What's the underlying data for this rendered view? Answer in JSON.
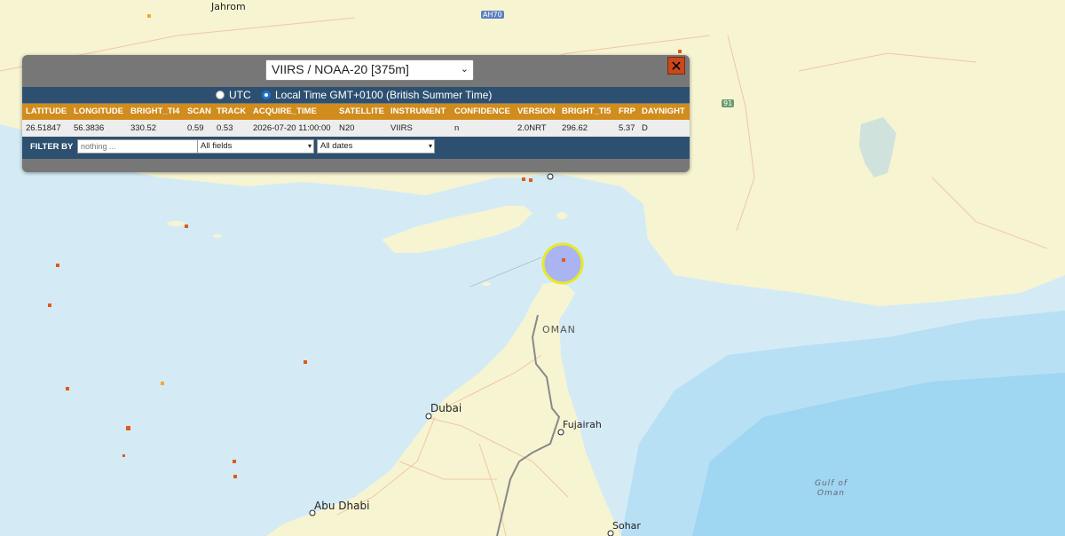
{
  "map": {
    "places": {
      "jahrom": "Jahrom",
      "oman": "OMAN",
      "dubai": "Dubai",
      "fujairah": "Fujairah",
      "abu_dhabi": "Abu Dhabi",
      "sohar": "Sohar",
      "gulf_of_oman": "Gulf of\nOman"
    },
    "shields": {
      "ah70": "AH70",
      "r91": "91"
    },
    "colors": {
      "land": "#f7f4d2",
      "water": "#d4ebf6",
      "deep_water": "#8fd0f0",
      "hotspot": "#e05a18",
      "selection": "#aab4f0",
      "selection_ring": "#e8e82a"
    }
  },
  "popup": {
    "satellite_select": "VIIRS / NOAA-20 [375m]",
    "close": "✕",
    "time": {
      "utc_label": "UTC",
      "local_label": "Local Time GMT+0100 (British Summer Time)",
      "selected": "local"
    },
    "columns": [
      "LATITUDE",
      "LONGITUDE",
      "BRIGHT_TI4",
      "SCAN",
      "TRACK",
      "ACQUIRE_TIME",
      "SATELLITE",
      "INSTRUMENT",
      "CONFIDENCE",
      "VERSION",
      "BRIGHT_TI5",
      "FRP",
      "DAYNIGHT"
    ],
    "row": [
      "26.51847",
      "56.3836",
      "330.52",
      "0.59",
      "0.53",
      "2026-07-20 11:00:00",
      "N20",
      "VIIRS",
      "n",
      "2.0NRT",
      "296.62",
      "5.37",
      "D"
    ],
    "filter": {
      "label": "FILTER BY",
      "placeholder": "nothing ...",
      "fields": "All fields",
      "dates": "All dates"
    },
    "colors": {
      "header": "#d08c1c",
      "bar": "#2d5070",
      "close": "#c9481b"
    }
  }
}
